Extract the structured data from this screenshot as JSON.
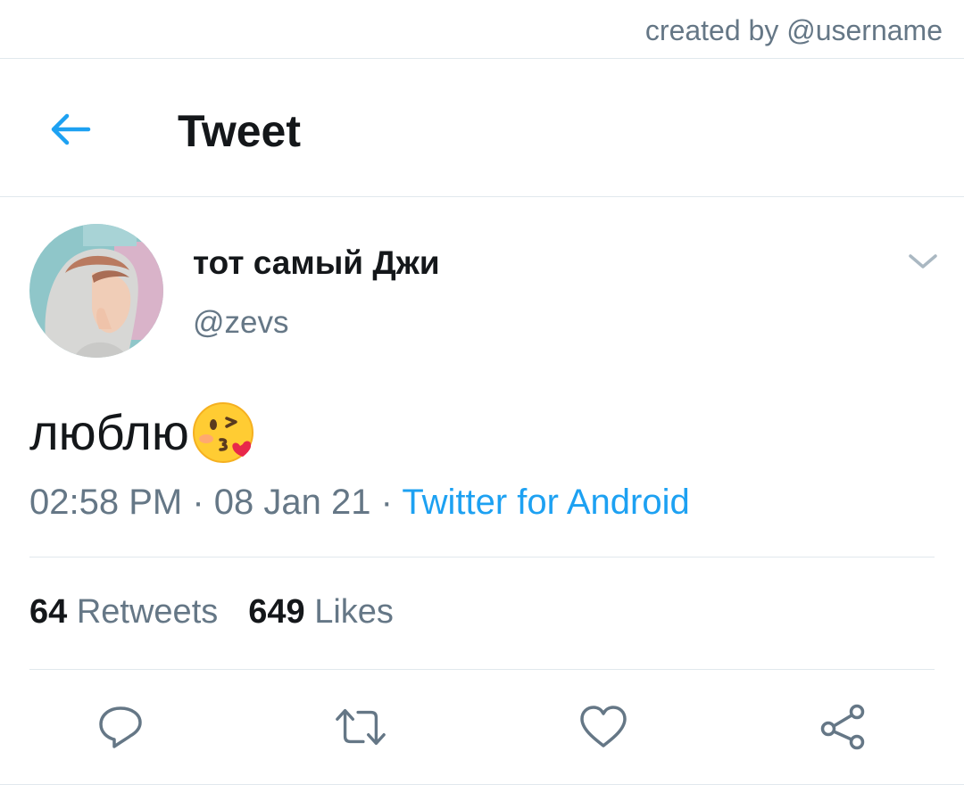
{
  "credit": {
    "text": "created by @username"
  },
  "header": {
    "title": "Tweet",
    "back_icon": "arrow-left-icon"
  },
  "tweet": {
    "display_name": "тот самый Джи",
    "handle": "@zevs",
    "text": "люблю",
    "emoji": "face-blowing-kiss-emoji",
    "time": "02:58 PM",
    "date": "08 Jan 21",
    "separator": "·",
    "source": "Twitter for Android"
  },
  "stats": {
    "retweets_count": "64",
    "retweets_label": "Retweets",
    "likes_count": "649",
    "likes_label": "Likes"
  },
  "actions": [
    "reply-icon",
    "retweet-icon",
    "like-icon",
    "share-icon"
  ],
  "colors": {
    "accent": "#1da1f2",
    "secondary_text": "#657786",
    "primary_text": "#14171a",
    "divider": "#e1e8ed"
  }
}
